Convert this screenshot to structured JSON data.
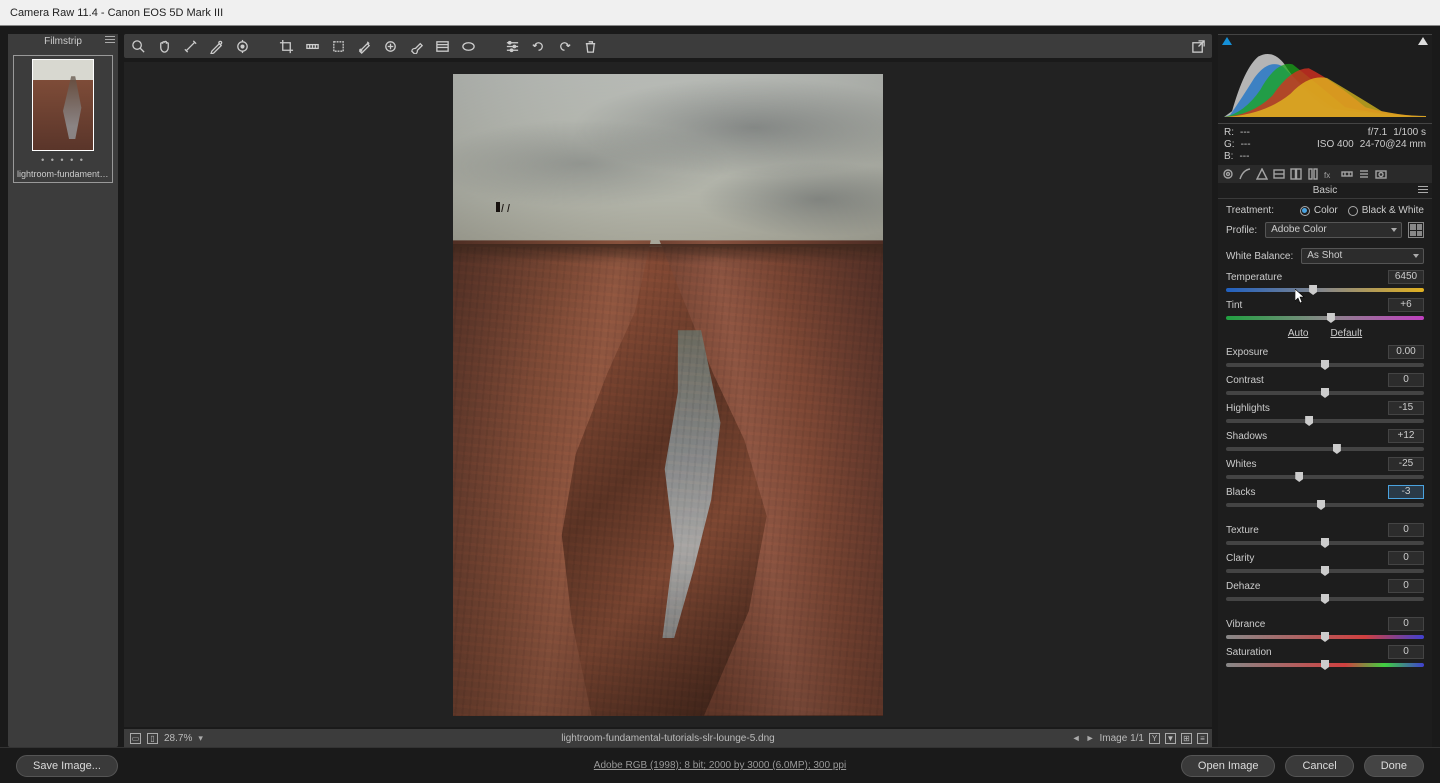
{
  "title": "Camera Raw 11.4  -  Canon EOS 5D Mark III",
  "filmstrip": {
    "header": "Filmstrip",
    "thumb_name": "lightroom-fundamental-tutori..."
  },
  "zoom_level": "28.7%",
  "status_filename": "lightroom-fundamental-tutorials-slr-lounge-5.dng",
  "status_imagecount": "Image 1/1",
  "exif": {
    "r": "R:",
    "r_val": "---",
    "g": "G:",
    "g_val": "---",
    "b": "B:",
    "b_val": "---",
    "aperture": "f/7.1",
    "shutter": "1/100 s",
    "iso": "ISO 400",
    "lens": "24-70@24 mm"
  },
  "panel_title": "Basic",
  "treatment": {
    "label": "Treatment:",
    "color": "Color",
    "bw": "Black & White"
  },
  "profile": {
    "label": "Profile:",
    "value": "Adobe Color"
  },
  "wb": {
    "label": "White Balance:",
    "value": "As Shot"
  },
  "sliders": {
    "temperature": {
      "label": "Temperature",
      "value": "6450",
      "pos": 44
    },
    "tint": {
      "label": "Tint",
      "value": "+6",
      "pos": 53
    },
    "exposure": {
      "label": "Exposure",
      "value": "0.00",
      "pos": 50
    },
    "contrast": {
      "label": "Contrast",
      "value": "0",
      "pos": 50
    },
    "highlights": {
      "label": "Highlights",
      "value": "-15",
      "pos": 42
    },
    "shadows": {
      "label": "Shadows",
      "value": "+12",
      "pos": 56
    },
    "whites": {
      "label": "Whites",
      "value": "-25",
      "pos": 37
    },
    "blacks": {
      "label": "Blacks",
      "value": "-3",
      "pos": 48,
      "active": true
    },
    "texture": {
      "label": "Texture",
      "value": "0",
      "pos": 50
    },
    "clarity": {
      "label": "Clarity",
      "value": "0",
      "pos": 50
    },
    "dehaze": {
      "label": "Dehaze",
      "value": "0",
      "pos": 50
    },
    "vibrance": {
      "label": "Vibrance",
      "value": "0",
      "pos": 50
    },
    "saturation": {
      "label": "Saturation",
      "value": "0",
      "pos": 50
    }
  },
  "auto_label": "Auto",
  "default_label": "Default",
  "bottom_info": "Adobe RGB (1998); 8 bit; 2000 by 3000 (6.0MP); 300 ppi",
  "buttons": {
    "save": "Save Image...",
    "open": "Open Image",
    "cancel": "Cancel",
    "done": "Done"
  }
}
